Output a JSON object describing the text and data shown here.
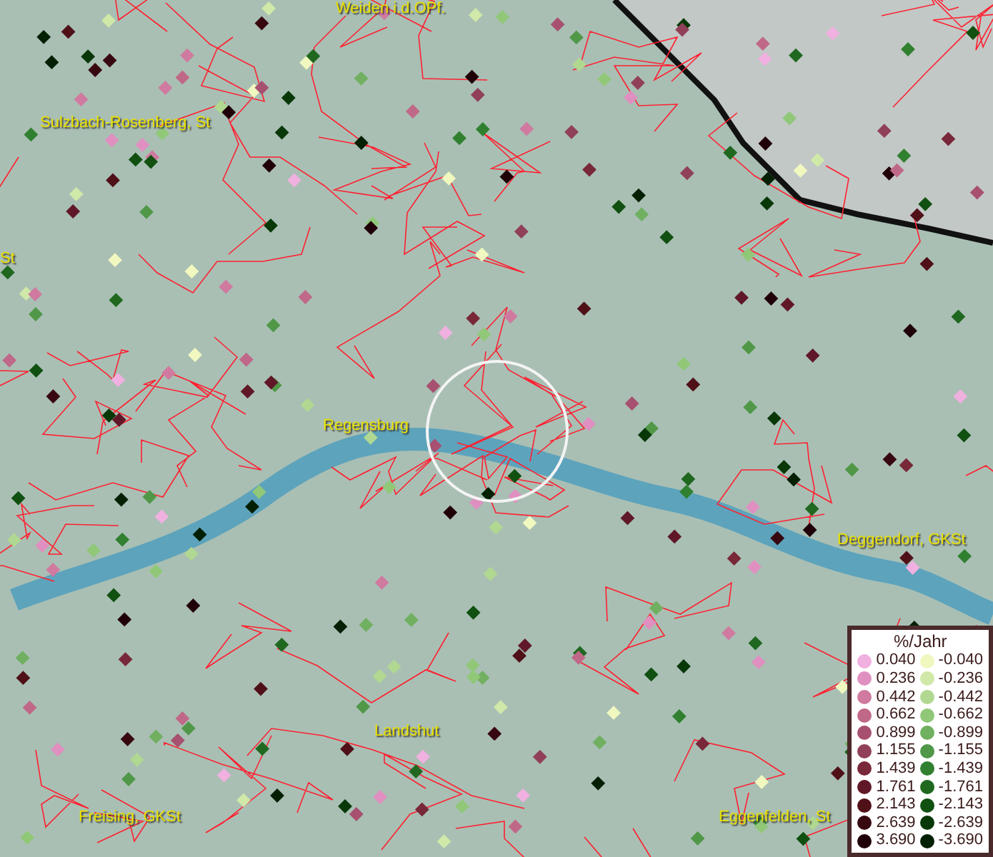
{
  "map": {
    "places": [
      {
        "name": "Weiden i.d.OPf."
      },
      {
        "name": "Sulzbach-Rosenberg, St"
      },
      {
        "name": "St"
      },
      {
        "name": "Regensburg"
      },
      {
        "name": "Deggendorf, GKSt"
      },
      {
        "name": "Landshut"
      },
      {
        "name": "Freising, GKSt"
      },
      {
        "name": "Eggenfelden, St"
      }
    ]
  },
  "legend": {
    "title": "%/Jahr",
    "rows": [
      {
        "positive": {
          "value": "0.040",
          "color": "#f0b0e0"
        },
        "negative": {
          "value": "-0.040",
          "color": "#f0f8c0"
        }
      },
      {
        "positive": {
          "value": "0.236",
          "color": "#e090c0"
        },
        "negative": {
          "value": "-0.236",
          "color": "#d0e8a8"
        }
      },
      {
        "positive": {
          "value": "0.442",
          "color": "#d07aa0"
        },
        "negative": {
          "value": "-0.442",
          "color": "#b0d890"
        }
      },
      {
        "positive": {
          "value": "0.662",
          "color": "#c06888"
        },
        "negative": {
          "value": "-0.662",
          "color": "#90c878"
        }
      },
      {
        "positive": {
          "value": "0.899",
          "color": "#a85070"
        },
        "negative": {
          "value": "-0.899",
          "color": "#70b060"
        }
      },
      {
        "positive": {
          "value": "1.155",
          "color": "#904058"
        },
        "negative": {
          "value": "-1.155",
          "color": "#509848"
        }
      },
      {
        "positive": {
          "value": "1.439",
          "color": "#782838"
        },
        "negative": {
          "value": "-1.439",
          "color": "#308030"
        }
      },
      {
        "positive": {
          "value": "1.761",
          "color": "#601828"
        },
        "negative": {
          "value": "-1.761",
          "color": "#206820"
        }
      },
      {
        "positive": {
          "value": "2.143",
          "color": "#501018"
        },
        "negative": {
          "value": "-2.143",
          "color": "#105010"
        }
      },
      {
        "positive": {
          "value": "2.639",
          "color": "#380810"
        },
        "negative": {
          "value": "-2.639",
          "color": "#083808"
        }
      },
      {
        "positive": {
          "value": "3.690",
          "color": "#200008"
        },
        "negative": {
          "value": "-3.690",
          "color": "#042004"
        }
      }
    ]
  }
}
